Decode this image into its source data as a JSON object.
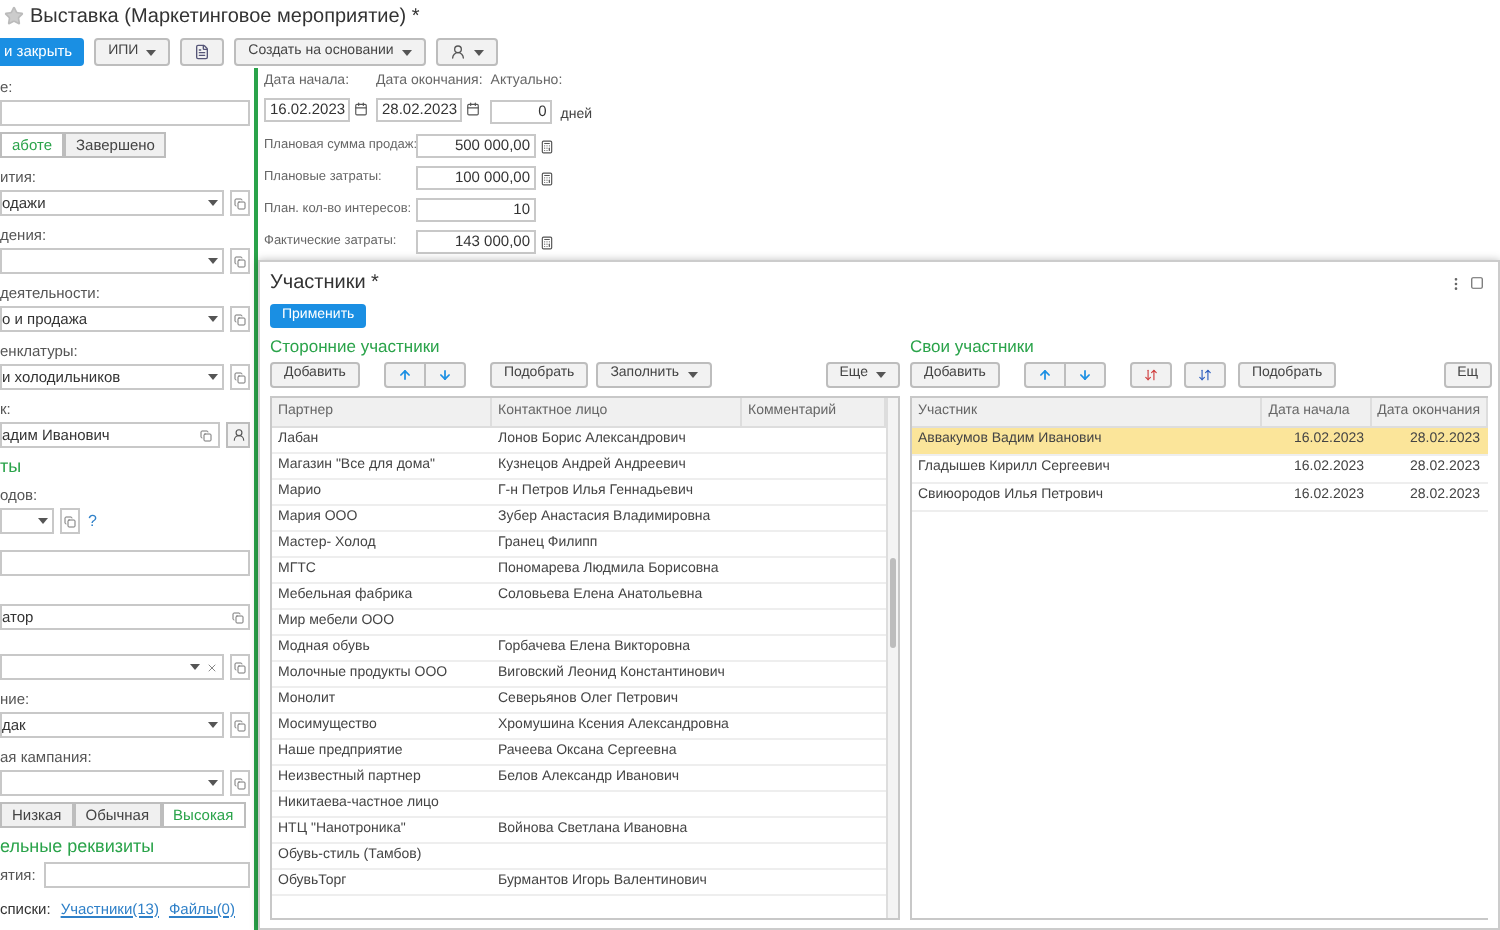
{
  "window": {
    "title": "Выставка (Маркетинговое мероприятие) *"
  },
  "toolbar": [
    {
      "kind": "primary",
      "label": "и закрыть"
    },
    {
      "kind": "menu",
      "label": "ИПИ"
    },
    {
      "kind": "doc"
    },
    {
      "kind": "menu",
      "label": "Создать на основании"
    },
    {
      "kind": "person_menu"
    }
  ],
  "left_panel": [
    {
      "kind": "label",
      "text": "е:"
    },
    {
      "kind": "field"
    },
    {
      "kind": "segments",
      "options": [
        {
          "label": "аботе",
          "selected": true
        },
        {
          "label": "Завершено",
          "selected": false
        }
      ]
    },
    {
      "kind": "label",
      "text": "ития:"
    },
    {
      "kind": "combo",
      "value": "одажи"
    },
    {
      "kind": "label",
      "text": "дения:"
    },
    {
      "kind": "combo"
    },
    {
      "kind": "label",
      "text": "деятельности:"
    },
    {
      "kind": "combo",
      "value": "о и продажа"
    },
    {
      "kind": "label",
      "text": "енклатуры:"
    },
    {
      "kind": "combo",
      "value": "и холодильников"
    },
    {
      "kind": "label",
      "text": "к:"
    },
    {
      "kind": "person",
      "value": "адим Иванович"
    },
    {
      "kind": "header",
      "text": "ты"
    },
    {
      "kind": "label",
      "text": "одов:"
    },
    {
      "kind": "combo_help",
      "help": "?"
    },
    {
      "kind": "field"
    },
    {
      "kind": "field_open",
      "value": "атор"
    },
    {
      "kind": "combo_clear"
    },
    {
      "kind": "label",
      "text": "ние:"
    },
    {
      "kind": "combo",
      "value": "дак"
    },
    {
      "kind": "label",
      "text": "ая кампания:"
    },
    {
      "kind": "combo"
    },
    {
      "kind": "segments",
      "options": [
        {
          "label": "Низкая",
          "selected": false
        },
        {
          "label": "Обычная",
          "selected": false
        },
        {
          "label": "Высокая",
          "selected": true
        }
      ]
    },
    {
      "kind": "header",
      "text": "ельные реквизиты"
    },
    {
      "kind": "inline_field",
      "label": "ятия:"
    },
    {
      "kind": "links",
      "label": "списки:",
      "links": [
        "Участники(13)",
        "Файлы(0)"
      ]
    }
  ],
  "dates": [
    {
      "label": "Дата начала:",
      "value": "16.02.2023",
      "kind": "date"
    },
    {
      "label": "Дата окончания:",
      "value": "28.02.2023",
      "kind": "date"
    },
    {
      "label": "Актуально:",
      "value": "0",
      "kind": "days",
      "unit": "дней"
    }
  ],
  "amounts": [
    {
      "label": "Плановая сумма продаж:",
      "value": "500 000,00",
      "kind": "money"
    },
    {
      "label": "Плановые затраты:",
      "value": "100 000,00",
      "kind": "money"
    },
    {
      "label": "План. кол-во интересов:",
      "value": "10",
      "kind": "count"
    },
    {
      "label": "Фактические затраты:",
      "value": "143 000,00",
      "kind": "money"
    }
  ],
  "dialog": {
    "title": "Участники *",
    "apply": "Применить",
    "external": {
      "title": "Сторонние участники",
      "toolbar": [
        {
          "kind": "button",
          "label": "Добавить"
        },
        {
          "kind": "arrows"
        },
        {
          "kind": "button",
          "label": "Подобрать"
        },
        {
          "kind": "menu",
          "label": "Заполнить"
        }
      ],
      "more": "Еще",
      "columns": [
        "Партнер",
        "Контактное лицо",
        "Комментарий"
      ],
      "rows": [
        {
          "partner": "Лабан",
          "contact": "Лонов Борис Александрович"
        },
        {
          "partner": "Магазин \"Все для дома\"",
          "contact": "Кузнецов Андрей Андреевич"
        },
        {
          "partner": "Марио",
          "contact": "Г-н Петров Илья Геннадьевич"
        },
        {
          "partner": "Мария ООО",
          "contact": "Зубер Анастасия Владимировна"
        },
        {
          "partner": "Мастер- Холод",
          "contact": "Гранец Филипп"
        },
        {
          "partner": "МГТС",
          "contact": "Пономарева Людмила Борисовна"
        },
        {
          "partner": "Мебельная фабрика",
          "contact": "Соловьева Елена Анатольевна"
        },
        {
          "partner": "Мир мебели ООО"
        },
        {
          "partner": "Модная обувь",
          "contact": "Горбачева Елена Викторовна"
        },
        {
          "partner": "Молочные продукты ООО",
          "contact": "Виговский Леонид Константинович"
        },
        {
          "partner": "Монолит",
          "contact": "Северьянов Олег  Петрович"
        },
        {
          "partner": "Мосимущество",
          "contact": "Хромушина Ксения Александровна"
        },
        {
          "partner": "Наше предприятие",
          "contact": "Рачеева Оксана Сергеевна"
        },
        {
          "partner": "Неизвестный партнер",
          "contact": "Белов Александр Иванович"
        },
        {
          "partner": "Никитаева-частное лицо"
        },
        {
          "partner": "НТЦ \"Нанотроника\"",
          "contact": "Войнова Светлана Ивановна"
        },
        {
          "partner": "Обувь-стиль (Тамбов)"
        },
        {
          "partner": "ОбувьТорг",
          "contact": "Бурмантов Игорь Валентинович"
        }
      ]
    },
    "own": {
      "title": "Свои участники",
      "toolbar": [
        {
          "kind": "button",
          "label": "Добавить"
        },
        {
          "kind": "arrows"
        },
        {
          "kind": "sort_asc"
        },
        {
          "kind": "sort_desc"
        },
        {
          "kind": "button",
          "label": "Подобрать"
        }
      ],
      "more": "Ещ",
      "columns": [
        "Участник",
        "Дата начала",
        "Дата окончания"
      ],
      "rows": [
        {
          "participant": "Аввакумов Вадим Иванович",
          "start": "16.02.2023",
          "end": "28.02.2023",
          "selected": true
        },
        {
          "participant": "Гладышев Кирилл Сергеевич",
          "start": "16.02.2023",
          "end": "28.02.2023",
          "selected": false
        },
        {
          "participant": "Свиюородов Илья Петрович",
          "start": "16.02.2023",
          "end": "28.02.2023",
          "selected": false
        }
      ]
    }
  }
}
